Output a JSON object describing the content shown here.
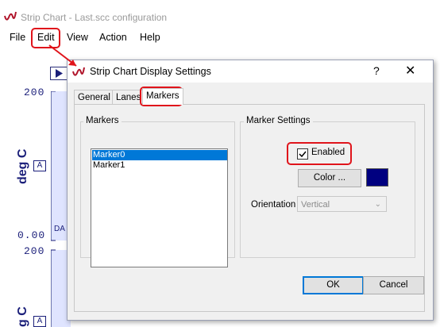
{
  "window": {
    "title": "Strip Chart - Last.scc configuration"
  },
  "menu": [
    "File",
    "Edit",
    "View",
    "Action",
    "Help"
  ],
  "chart": {
    "lane1": {
      "ymax": "200",
      "ymin": "0.00",
      "unit": "deg C",
      "axis_label": "A",
      "trace_label": "DA"
    },
    "lane2": {
      "ymax": "200",
      "unit": "g C",
      "axis_label": "A"
    }
  },
  "dialog": {
    "title": "Strip Chart Display Settings",
    "help": "?",
    "close": "✕",
    "tabs": [
      "General",
      "Lanes",
      "Markers"
    ],
    "active_tab": "Markers",
    "markers_group": {
      "label": "Markers",
      "items": [
        "Marker0",
        "Marker1"
      ],
      "selected": "Marker0"
    },
    "settings_group": {
      "label": "Marker Settings",
      "enabled_label": "Enabled",
      "enabled": true,
      "color_button": "Color ...",
      "color_value": "#000080",
      "orientation_label": "Orientation",
      "orientation_value": "Vertical"
    },
    "buttons": {
      "ok": "OK",
      "cancel": "Cancel"
    }
  },
  "colors": {
    "annotation": "#e0141b",
    "chart_text": "#1b1f7a",
    "selection": "#0078d7"
  }
}
